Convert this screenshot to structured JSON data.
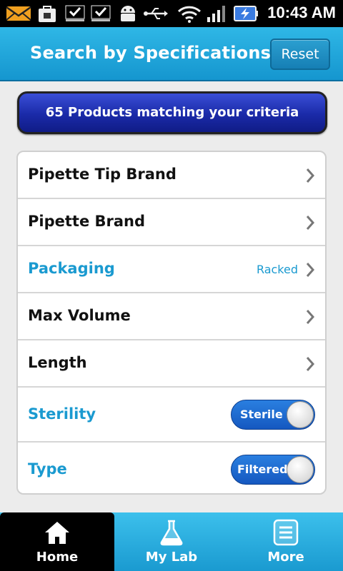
{
  "status_bar": {
    "time": "10:43 AM",
    "icons": [
      "mail-icon",
      "bag-icon",
      "checklist-icon",
      "checklist-icon",
      "android-icon",
      "usb-icon",
      "wifi-icon",
      "signal-icon",
      "battery-icon"
    ]
  },
  "header": {
    "title": "Search by Specifications",
    "reset_label": "Reset"
  },
  "match_banner": {
    "text": "65 Products matching your criteria"
  },
  "specs": [
    {
      "label": "Pipette Tip Brand",
      "value": "",
      "active": false
    },
    {
      "label": "Pipette Brand",
      "value": "",
      "active": false
    },
    {
      "label": "Packaging",
      "value": "Racked",
      "active": true
    },
    {
      "label": "Max Volume",
      "value": "",
      "active": false
    },
    {
      "label": "Length",
      "value": "",
      "active": false
    },
    {
      "label": "Sterility",
      "toggle": "Sterile",
      "active": true
    },
    {
      "label": "Type",
      "toggle": "Filtered",
      "active": true
    }
  ],
  "tabs": [
    {
      "label": "Home",
      "icon": "home-icon",
      "selected": true
    },
    {
      "label": "My Lab",
      "icon": "flask-icon",
      "selected": false
    },
    {
      "label": "More",
      "icon": "list-icon",
      "selected": false
    }
  ],
  "colors": {
    "accent": "#1a9ad0",
    "header": "#1596cf",
    "banner": "#1a2aa8",
    "toggle": "#1558c0"
  }
}
